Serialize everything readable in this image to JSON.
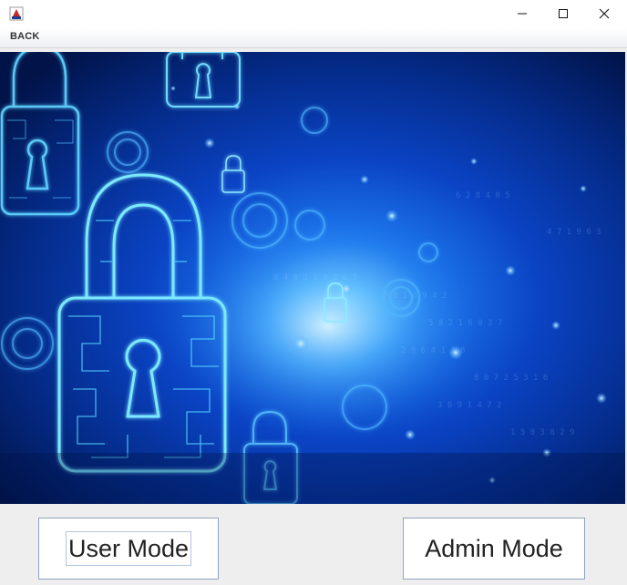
{
  "window": {
    "icons": {
      "app": "java-cup-icon",
      "minimize": "minimize-icon",
      "maximize": "maximize-icon",
      "close": "close-icon"
    }
  },
  "menu": {
    "back_label": "BACK"
  },
  "banner": {
    "image": "cyber-security-padlock-background",
    "colors": {
      "deep": "#021a5c",
      "mid": "#0a4fd6",
      "glow": "#3fa9ff",
      "cyan": "#69e3ff"
    }
  },
  "buttons": {
    "user_mode_label": "User Mode",
    "admin_mode_label": "Admin Mode"
  }
}
